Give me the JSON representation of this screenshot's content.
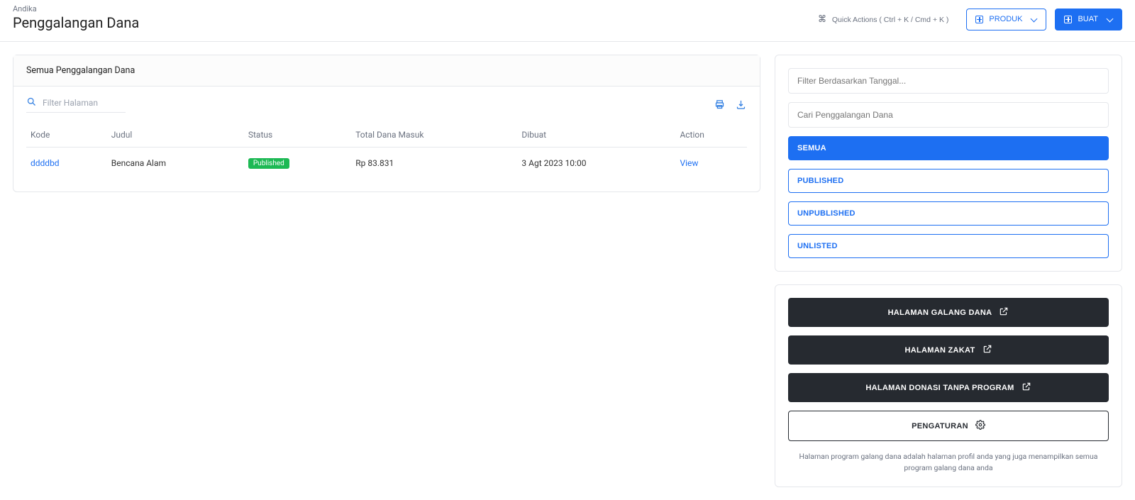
{
  "breadcrumb": "Andika",
  "page_title": "Penggalangan Dana",
  "top": {
    "quick_actions": "Quick Actions ( Ctrl + K / Cmd + K )",
    "product": "PRODUK",
    "create": "BUAT"
  },
  "list": {
    "card_title": "Semua Penggalangan Dana",
    "filter_placeholder": "Filter Halaman",
    "columns": {
      "kode": "Kode",
      "judul": "Judul",
      "status": "Status",
      "total": "Total Dana Masuk",
      "dibuat": "Dibuat",
      "action": "Action"
    },
    "rows": [
      {
        "kode": "ddddbd",
        "judul": "Bencana Alam",
        "status": "Published",
        "total": "Rp 83.831",
        "dibuat": "3 Agt 2023 10:00",
        "action": "View"
      }
    ]
  },
  "filters": {
    "date_placeholder": "Filter Berdasarkan Tanggal...",
    "search_placeholder": "Cari Penggalangan Dana",
    "tabs": {
      "semua": "SEMUA",
      "published": "PUBLISHED",
      "unpublished": "UNPUBLISHED",
      "unlisted": "UNLISTED"
    }
  },
  "side_actions": {
    "hal_galang": "HALAMAN GALANG DANA",
    "hal_zakat": "HALAMAN ZAKAT",
    "hal_donasi": "HALAMAN DONASI TANPA PROGRAM",
    "pengaturan": "PENGATURAN",
    "hint": "Halaman program galang dana adalah halaman profil anda yang juga menampilkan semua program galang dana anda"
  }
}
